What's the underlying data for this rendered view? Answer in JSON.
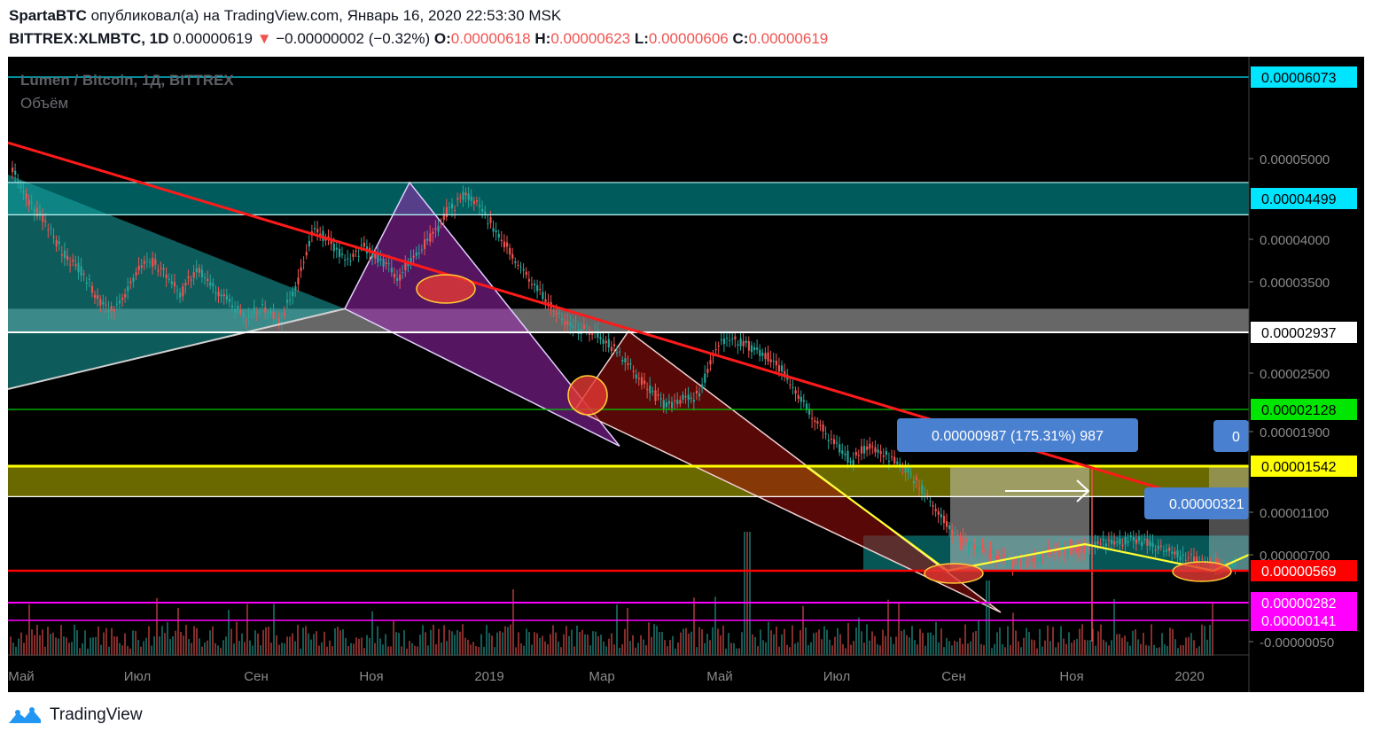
{
  "header": {
    "author": "SpartaBTC",
    "published_text": "опубликовал(а) на TradingView.com, Январь 16, 2020 22:53:30 MSK",
    "symbol": "BITTREX:XLMBTC, 1D",
    "last_price": "0.00000619",
    "change": "−0.00000002 (−0.32%)",
    "open_label": "O:",
    "open": "0.00000618",
    "high_label": "H:",
    "high": "0.00000623",
    "low_label": "L:",
    "low": "0.00000606",
    "close_label": "C:",
    "close": "0.00000619"
  },
  "legend": {
    "title": "Lumen / Bitcoin, 1Д, BITTREX",
    "volume": "Объём"
  },
  "chart_data": {
    "type": "candlestick",
    "title": "Lumen / Bitcoin, 1Д, BITTREX",
    "x_ticks": [
      "Май",
      "Июл",
      "Сен",
      "Ноя",
      "2019",
      "Мар",
      "Май",
      "Июл",
      "Сен",
      "Ноя",
      "2020"
    ],
    "y_ticks": [
      "0.00005000",
      "0.00004000",
      "0.00003500",
      "0.00002500",
      "0.00001900",
      "0.00001100",
      "0.00000700",
      "-0.00000050"
    ],
    "price_tags": [
      {
        "value": "0.00006073",
        "bg": "#00e5ff",
        "fg": "#000000"
      },
      {
        "value": "0.00004499",
        "bg": "#00e5ff",
        "fg": "#000000"
      },
      {
        "value": "0.00002937",
        "bg": "#ffffff",
        "fg": "#000000"
      },
      {
        "value": "0.00002128",
        "bg": "#00e600",
        "fg": "#000000"
      },
      {
        "value": "0.00001542",
        "bg": "#ffff00",
        "fg": "#000000"
      },
      {
        "value": "0.00000569",
        "bg": "#ff0000",
        "fg": "#ffffff"
      },
      {
        "value": "0.00000282",
        "bg": "#ff00ff",
        "fg": "#ffffff"
      },
      {
        "value": "0.00000141",
        "bg": "#ff00ff",
        "fg": "#ffffff"
      }
    ],
    "annotations": [
      "0.00000987 (175.31%) 987",
      "0.00000321",
      "0"
    ],
    "price_path": [
      [
        4.8e-05,
        4.9e-05
      ],
      [
        4.3e-05,
        4.6e-05
      ],
      [
        4e-05,
        4.4e-05
      ],
      [
        3.7e-05,
        4e-05
      ],
      [
        3.5e-05,
        3.8e-05
      ],
      [
        3.2e-05,
        3.5e-05
      ],
      [
        3e-05,
        3.3e-05
      ],
      [
        3.3e-05,
        3.6e-05
      ],
      [
        3.6e-05,
        4e-05
      ],
      [
        3.4e-05,
        3.8e-05
      ],
      [
        3.2e-05,
        3.5e-05
      ],
      [
        3.5e-05,
        3.8e-05
      ],
      [
        3.3e-05,
        3.6e-05
      ],
      [
        3.1e-05,
        3.4e-05
      ],
      [
        3e-05,
        3.2e-05
      ],
      [
        3.1e-05,
        3.3e-05
      ],
      [
        2.95e-05,
        3.15e-05
      ],
      [
        3.3e-05,
        3.7e-05
      ],
      [
        4e-05,
        4.3e-05
      ],
      [
        3.8e-05,
        4.1e-05
      ],
      [
        3.6e-05,
        3.9e-05
      ],
      [
        3.8e-05,
        4e-05
      ],
      [
        3.6e-05,
        3.9e-05
      ],
      [
        3.4e-05,
        3.7e-05
      ],
      [
        3.7e-05,
        3.9e-05
      ],
      [
        3.9e-05,
        4.2e-05
      ],
      [
        4.2e-05,
        4.5e-05
      ],
      [
        4.4e-05,
        4.7e-05
      ],
      [
        4.2e-05,
        4.5e-05
      ],
      [
        3.9e-05,
        4.2e-05
      ],
      [
        3.6e-05,
        3.9e-05
      ],
      [
        3.4e-05,
        3.6e-05
      ],
      [
        3.1e-05,
        3.4e-05
      ],
      [
        2.95e-05,
        3.15e-05
      ],
      [
        2.9e-05,
        3.05e-05
      ],
      [
        2.8e-05,
        3e-05
      ],
      [
        2.65e-05,
        2.85e-05
      ],
      [
        2.4e-05,
        2.65e-05
      ],
      [
        2.2e-05,
        2.45e-05
      ],
      [
        2.1e-05,
        2.25e-05
      ],
      [
        2.15e-05,
        2.3e-05
      ],
      [
        2.2e-05,
        2.4e-05
      ],
      [
        2.7e-05,
        2.9e-05
      ],
      [
        2.8e-05,
        2.95e-05
      ],
      [
        2.7e-05,
        2.85e-05
      ],
      [
        2.6e-05,
        2.75e-05
      ],
      [
        2.4e-05,
        2.6e-05
      ],
      [
        2.15e-05,
        2.35e-05
      ],
      [
        1.9e-05,
        2.1e-05
      ],
      [
        1.7e-05,
        1.9e-05
      ],
      [
        1.5e-05,
        1.7e-05
      ],
      [
        1.65e-05,
        1.85e-05
      ],
      [
        1.6e-05,
        1.7e-05
      ],
      [
        1.5e-05,
        1.65e-05
      ],
      [
        1.3e-05,
        1.45e-05
      ],
      [
        1.05e-05,
        1.25e-05
      ],
      [
        8.5e-06,
        1e-05
      ],
      [
        7.5e-06,
        8.5e-06
      ],
      [
        7e-06,
        8e-06
      ],
      [
        6.2e-06,
        7.2e-06
      ],
      [
        6e-06,
        6.6e-06
      ],
      [
        6.2e-06,
        7e-06
      ],
      [
        6.8e-06,
        7.6e-06
      ],
      [
        7e-06,
        7.8e-06
      ],
      [
        7.2e-06,
        8e-06
      ],
      [
        7.5e-06,
        8.5e-06
      ],
      [
        7.8e-06,
        8.8e-06
      ],
      [
        8e-06,
        8.8e-06
      ],
      [
        7.5e-06,
        8.2e-06
      ],
      [
        7e-06,
        7.6e-06
      ],
      [
        6.5e-06,
        7e-06
      ],
      [
        6e-06,
        6.5e-06
      ],
      [
        5.9e-06,
        6.4e-06
      ],
      [
        6e-06,
        6.6e-06
      ]
    ]
  },
  "footer": {
    "brand": "TradingView"
  }
}
